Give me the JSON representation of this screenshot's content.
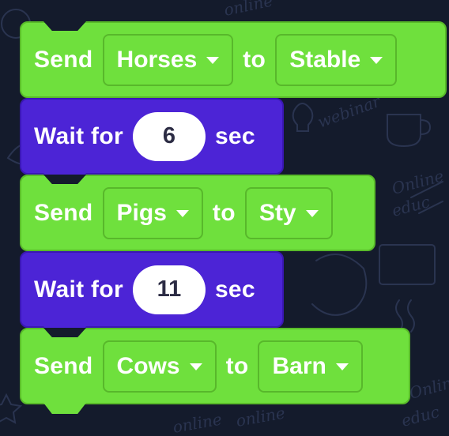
{
  "colors": {
    "background": "#141b2c",
    "send_block": "#6fe03d",
    "wait_block": "#4c24d6",
    "pill": "#ffffff"
  },
  "background_doodles": {
    "texts": [
      "online",
      "webinar",
      "Online",
      "educ",
      "online",
      "online",
      "Online",
      "educ"
    ]
  },
  "blocks": [
    {
      "type": "send",
      "keyword": "Send",
      "animal": "Horses",
      "connector": "to",
      "location": "Stable"
    },
    {
      "type": "wait",
      "keyword": "Wait for",
      "seconds": "6",
      "unit": "sec"
    },
    {
      "type": "send",
      "keyword": "Send",
      "animal": "Pigs",
      "connector": "to",
      "location": "Sty"
    },
    {
      "type": "wait",
      "keyword": "Wait for",
      "seconds": "11",
      "unit": "sec"
    },
    {
      "type": "send",
      "keyword": "Send",
      "animal": "Cows",
      "connector": "to",
      "location": "Barn"
    }
  ]
}
